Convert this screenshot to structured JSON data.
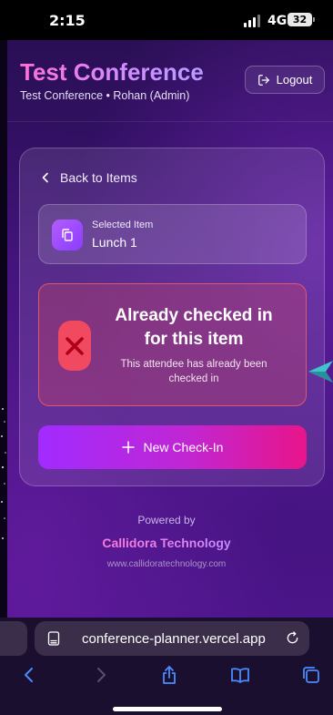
{
  "status_bar": {
    "time": "2:15",
    "network": "4G",
    "battery": "32"
  },
  "header": {
    "title": "Test Conference",
    "subtitle": "Test Conference • Rohan (Admin)",
    "logout_label": "Logout"
  },
  "card": {
    "back_label": "Back to Items",
    "selected_item": {
      "label": "Selected Item",
      "value": "Lunch 1"
    },
    "alert": {
      "title": "Already checked in for this item",
      "message": "This attendee has already been checked in"
    },
    "new_checkin_label": "New Check-In"
  },
  "footer": {
    "powered_by": "Powered by",
    "brand": "Callidora Technology",
    "website": "www.callidoratechnology.com"
  },
  "browser": {
    "url": "conference-planner.vercel.app"
  },
  "colors": {
    "accent_pink": "#e8158a",
    "accent_purple": "#a12bff",
    "error_red": "#f1495f"
  }
}
